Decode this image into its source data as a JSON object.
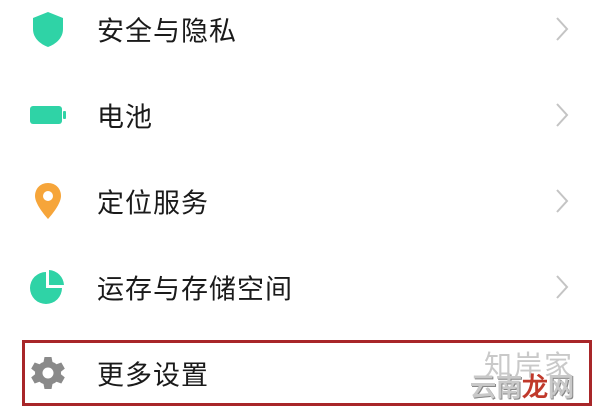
{
  "settings": {
    "items": [
      {
        "label": "安全与隐私",
        "icon": "shield-icon"
      },
      {
        "label": "电池",
        "icon": "battery-icon"
      },
      {
        "label": "定位服务",
        "icon": "location-pin-icon"
      },
      {
        "label": "运存与存储空间",
        "icon": "pie-chart-icon"
      },
      {
        "label": "更多设置",
        "icon": "gear-icon"
      }
    ]
  },
  "watermark": {
    "line1": "知岸家",
    "line2_part1": "云南",
    "line2_part2": "龙",
    "line2_part3": "网"
  },
  "colors": {
    "accent": "#2fd3a6",
    "location": "#f6a53a",
    "gear": "#8a8a8a",
    "highlight_border": "#a82629"
  }
}
